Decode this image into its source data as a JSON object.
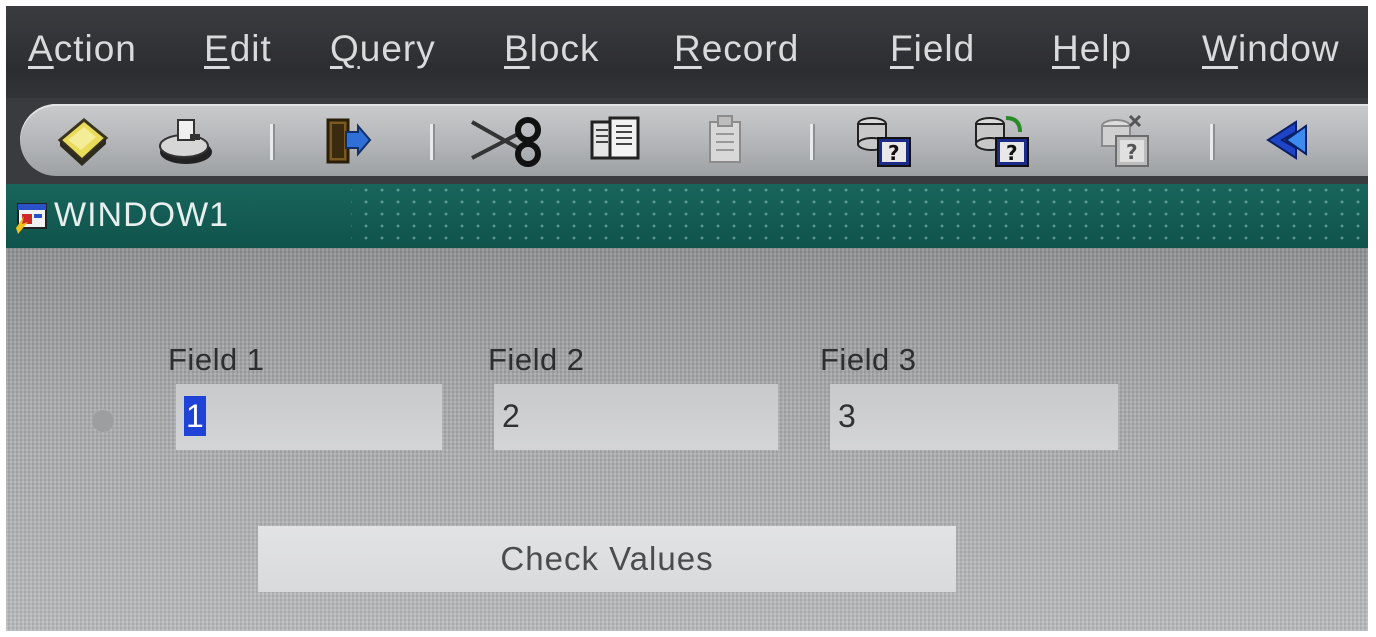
{
  "menubar": {
    "items": [
      {
        "key": "A",
        "rest": "ction"
      },
      {
        "key": "E",
        "rest": "dit"
      },
      {
        "key": "Q",
        "rest": "uery"
      },
      {
        "key": "B",
        "rest": "lock"
      },
      {
        "key": "R",
        "rest": "ecord"
      },
      {
        "key": "F",
        "rest": "ield"
      },
      {
        "key": "H",
        "rest": "elp"
      },
      {
        "key": "W",
        "rest": "indow"
      }
    ]
  },
  "toolbar": {
    "buttons": [
      "save-icon",
      "print-icon",
      "exit-icon",
      "cut-icon",
      "copy-icon",
      "paste-icon",
      "enter-query-icon",
      "execute-query-icon",
      "cancel-query-icon",
      "previous-block-icon"
    ]
  },
  "window": {
    "title": "WINDOW1"
  },
  "form": {
    "field1": {
      "label": "Field 1",
      "value": "1"
    },
    "field2": {
      "label": "Field 2",
      "value": "2"
    },
    "field3": {
      "label": "Field 3",
      "value": "3"
    },
    "button_label": "Check Values"
  },
  "colors": {
    "titlebar": "#18655c",
    "selection": "#1f43d6",
    "menubar": "#2c2d30"
  }
}
